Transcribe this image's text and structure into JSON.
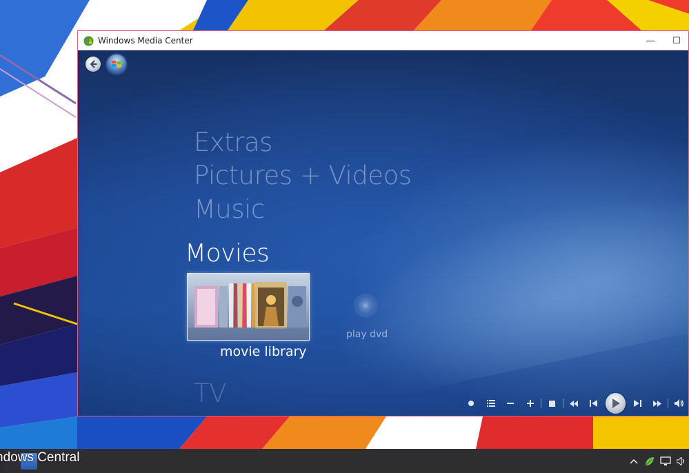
{
  "window": {
    "title": "Windows Media Center",
    "minimize_glyph": "—",
    "maximize_glyph": "☐"
  },
  "menu": {
    "items": [
      {
        "label": "Extras",
        "state": "inactive"
      },
      {
        "label": "Pictures + Videos",
        "state": "inactive"
      },
      {
        "label": "Music",
        "state": "inactive"
      },
      {
        "label": "Movies",
        "state": "selected"
      },
      {
        "label": "TV",
        "state": "inactive"
      }
    ]
  },
  "movies": {
    "tiles": [
      {
        "label": "movie library",
        "state": "focused",
        "icon": "movie-shelf"
      },
      {
        "label": "play dvd",
        "state": "normal",
        "icon": "dvd-disc-icon"
      }
    ]
  },
  "transport": {
    "controls": [
      "record",
      "guide",
      "volume-down",
      "volume-up",
      "stop",
      "rewind",
      "skip-back",
      "play",
      "skip-forward",
      "fast-forward",
      "volume"
    ]
  },
  "taskbar": {
    "watermark": "ndows Central",
    "tray_icons": [
      "chevron-up-icon",
      "leaf-icon",
      "network-icon",
      "speaker-icon"
    ]
  },
  "colors": {
    "accent_border": "#e05a80",
    "wmc_blue": "#1c4690",
    "taskbar": "#18181c"
  }
}
